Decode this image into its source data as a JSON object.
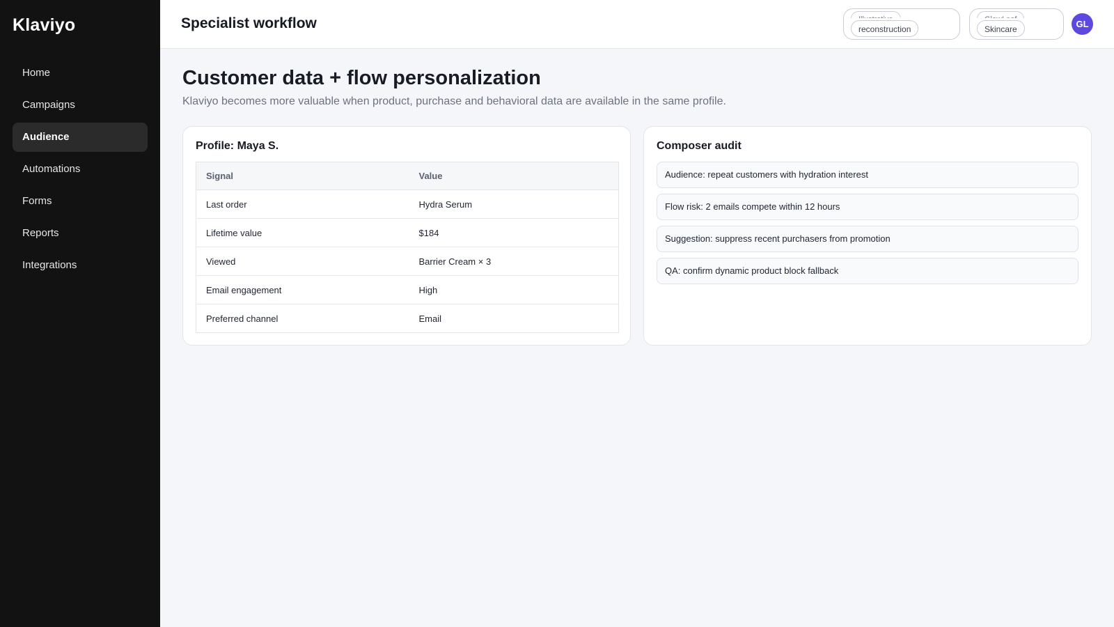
{
  "sidebar": {
    "brand": "Klaviyo",
    "items": [
      {
        "label": "Home",
        "active": false
      },
      {
        "label": "Campaigns",
        "active": false
      },
      {
        "label": "Audience",
        "active": true
      },
      {
        "label": "Automations",
        "active": false
      },
      {
        "label": "Forms",
        "active": false
      },
      {
        "label": "Reports",
        "active": false
      },
      {
        "label": "Integrations",
        "active": false
      }
    ]
  },
  "header": {
    "title": "Specialist workflow",
    "pill1": {
      "top_text": "Illustrative",
      "label": "reconstruction"
    },
    "pill2": {
      "top_text": "GlowLeaf",
      "label": "Skincare"
    },
    "avatar": "GL"
  },
  "main": {
    "title": "Customer data + flow personalization",
    "subtitle": "Klaviyo becomes more valuable when product, purchase and behavioral data are available in the same profile.",
    "profile": {
      "title": "Profile: Maya S.",
      "columns": [
        "Signal",
        "Value"
      ],
      "rows": [
        [
          "Last order",
          "Hydra Serum"
        ],
        [
          "Lifetime value",
          "$184"
        ],
        [
          "Viewed",
          "Barrier Cream × 3"
        ],
        [
          "Email engagement",
          "High"
        ],
        [
          "Preferred channel",
          "Email"
        ]
      ]
    },
    "audit": {
      "title": "Composer audit",
      "items": [
        "Audience: repeat customers with hydration interest",
        "Flow risk: 2 emails compete within 12 hours",
        "Suggestion: suppress recent purchasers from promotion",
        "QA: confirm dynamic product block fallback"
      ]
    }
  },
  "colors": {
    "sidebar_bg": "#121212",
    "active_item_bg": "#2b2b2b",
    "avatar_bg": "#5b49e0",
    "page_bg": "#f5f6fa"
  }
}
